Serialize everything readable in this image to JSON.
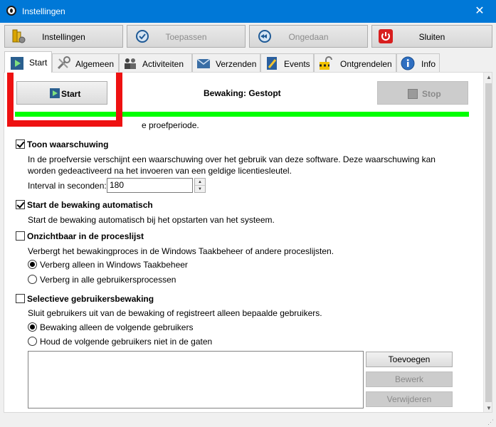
{
  "window": {
    "title": "Instellingen",
    "close_glyph": "✕"
  },
  "toolbar": {
    "buttons": [
      {
        "label": "Instellingen",
        "icon": "settings-icon",
        "enabled": true
      },
      {
        "label": "Toepassen",
        "icon": "apply-icon",
        "enabled": false
      },
      {
        "label": "Ongedaan",
        "icon": "undo-icon",
        "enabled": false
      },
      {
        "label": "Sluiten",
        "icon": "power-icon",
        "enabled": true
      }
    ]
  },
  "tabs": [
    {
      "label": "Start",
      "icon": "play-icon",
      "active": true
    },
    {
      "label": "Algemeen",
      "icon": "tools-icon"
    },
    {
      "label": "Activiteiten",
      "icon": "people-icon"
    },
    {
      "label": "Verzenden",
      "icon": "send-icon"
    },
    {
      "label": "Events",
      "icon": "document-icon"
    },
    {
      "label": "Ontgrendelen",
      "icon": "lock-icon"
    },
    {
      "label": "Info",
      "icon": "info-icon"
    }
  ],
  "monitor": {
    "start_label": "Start",
    "stop_label": "Stop",
    "status": "Bewaking: Gestopt",
    "status_color": "#00ff00"
  },
  "trial": {
    "note_visible_part": "e proefperiode."
  },
  "options": {
    "show_warning": {
      "label": "Toon waarschuwing",
      "checked": true,
      "desc_line1": "In de proefversie verschijnt een waarschuwing over het gebruik van deze software. Deze waarschuwing kan",
      "desc_line2": "worden gedeactiveerd na het invoeren van een geldige licentiesleutel.",
      "interval_label": "Interval in seconden:",
      "interval_value": "180"
    },
    "auto_start": {
      "label": "Start de bewaking automatisch",
      "checked": true,
      "desc": "Start de bewaking automatisch bij het opstarten van het systeem."
    },
    "invisible": {
      "label": "Onzichtbaar in de proceslijst",
      "checked": false,
      "desc": "Verbergt het bewakingproces in de Windows Taakbeheer of andere proceslijsten.",
      "radio1": "Verberg alleen in Windows Taakbeheer",
      "radio2": "Verberg in alle gebruikersprocessen",
      "selected": 1
    },
    "selective": {
      "label": "Selectieve gebruikersbewaking",
      "checked": false,
      "desc": "Sluit gebruikers uit van de bewaking of registreert alleen bepaalde gebruikers.",
      "radio1": "Bewaking alleen de volgende gebruikers",
      "radio2": "Houd de volgende gebruikers niet in de gaten",
      "selected": 1,
      "add_label": "Toevoegen",
      "edit_label": "Bewerk",
      "remove_label": "Verwijderen"
    }
  },
  "colors": {
    "titlebar": "#0078d7",
    "highlight": "#ee1111"
  }
}
